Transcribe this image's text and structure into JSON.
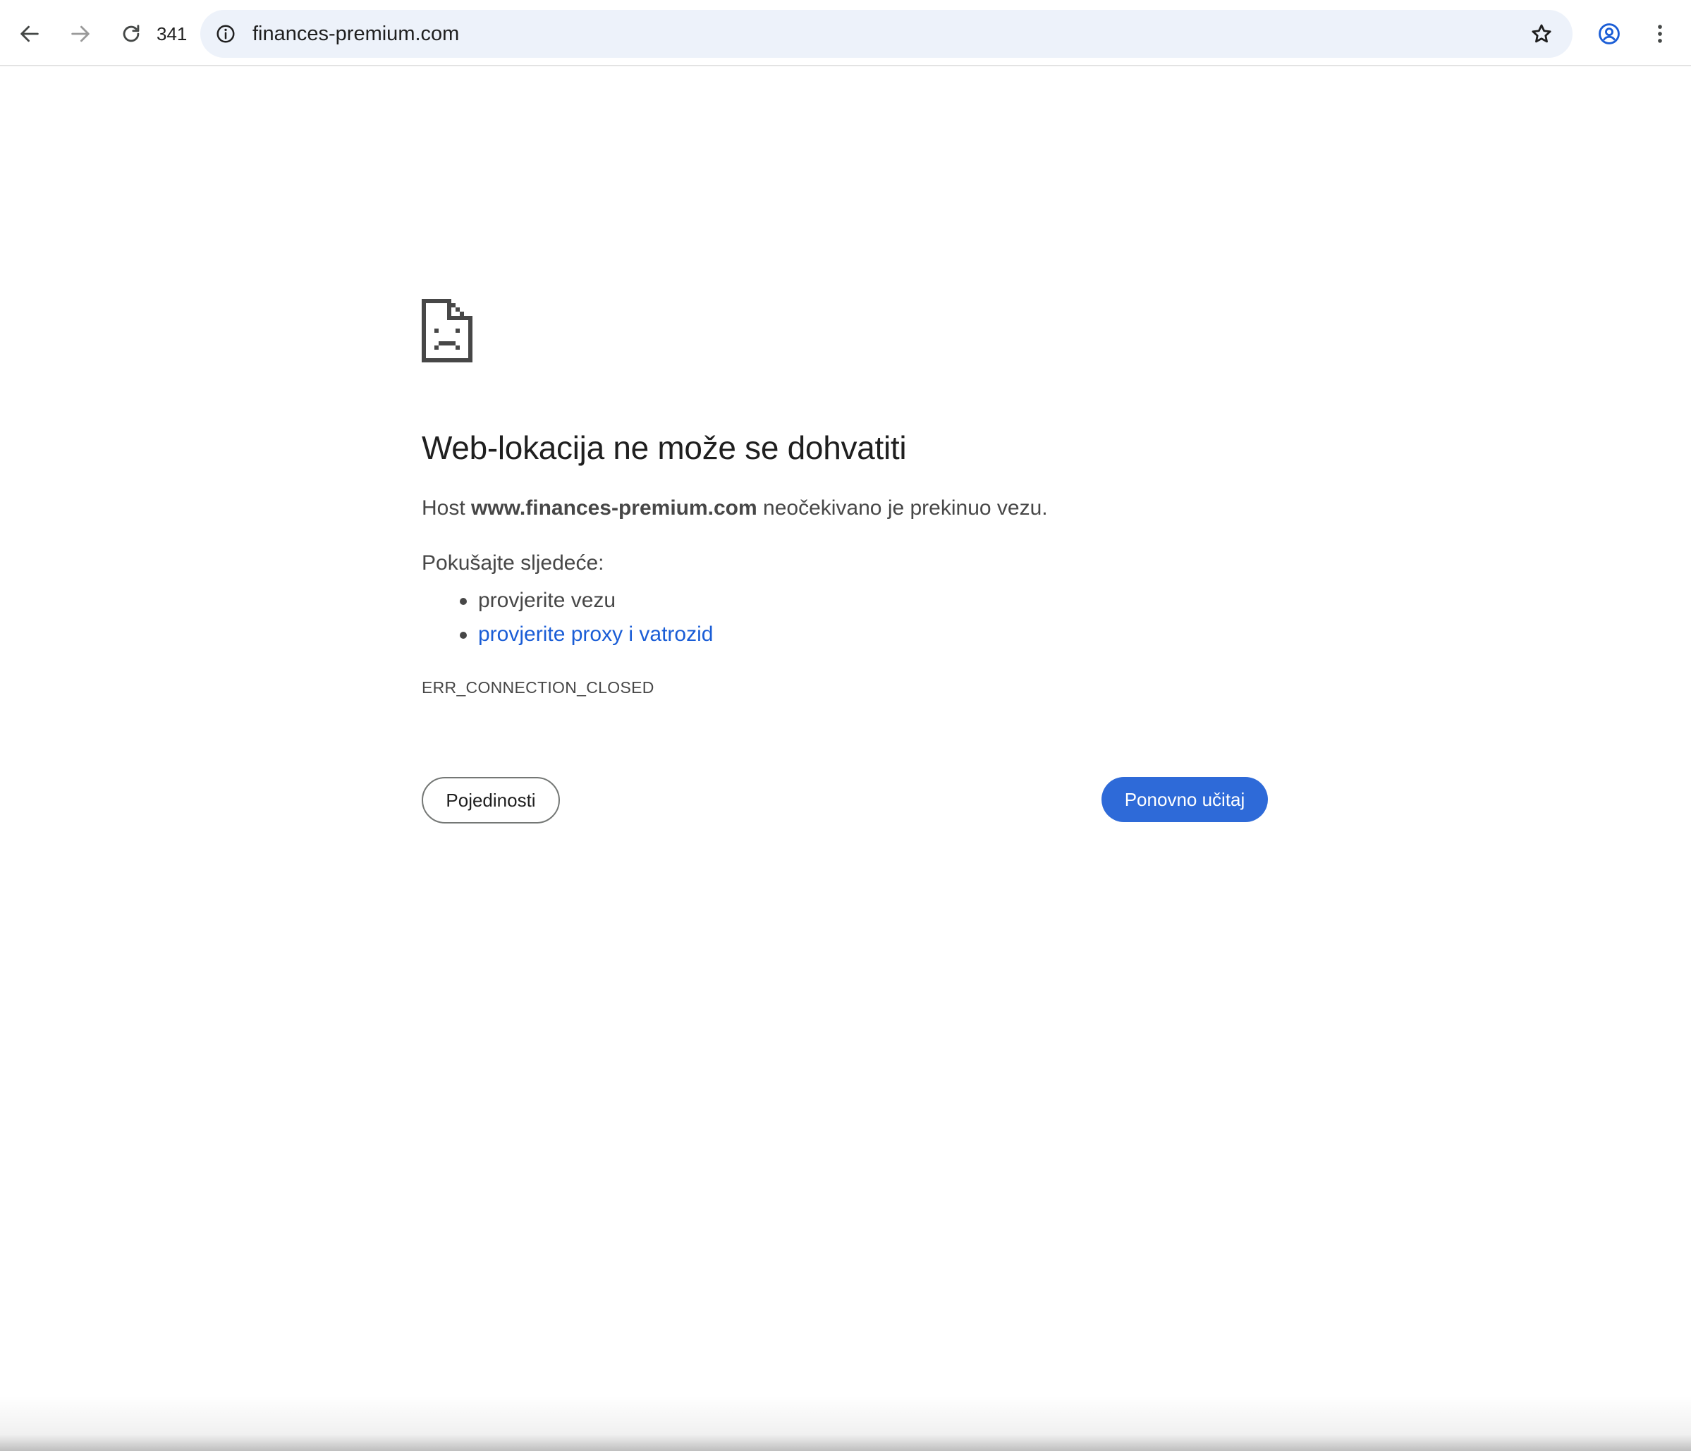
{
  "browser": {
    "tab_count": "341",
    "url": "finances-premium.com",
    "icons": {
      "back": "arrow-left",
      "forward": "arrow-right",
      "reload": "reload",
      "site_info": "info-circle",
      "bookmark": "star-outline",
      "profile": "account-circle",
      "menu": "three-dots-vertical"
    }
  },
  "error_page": {
    "icon": "sad-document",
    "title": "Web-lokacija ne može se dohvatiti",
    "description": {
      "prefix": "Host ",
      "host": "www.finances-premium.com",
      "suffix": " neočekivano je prekinuo vezu."
    },
    "suggestions_heading": "Pokušajte sljedeće:",
    "suggestions": [
      {
        "label": "provjerite vezu",
        "is_link": false
      },
      {
        "label": "provjerite proxy i vatrozid",
        "is_link": true
      }
    ],
    "error_code": "ERR_CONNECTION_CLOSED",
    "details_button": "Pojedinosti",
    "reload_button": "Ponovno učitaj"
  },
  "colors": {
    "omnibox_bg": "#edf2fa",
    "link": "#1a5dd6",
    "primary_button": "#2e6ad8",
    "text_primary": "#1f1f1f",
    "text_secondary": "#474747"
  }
}
